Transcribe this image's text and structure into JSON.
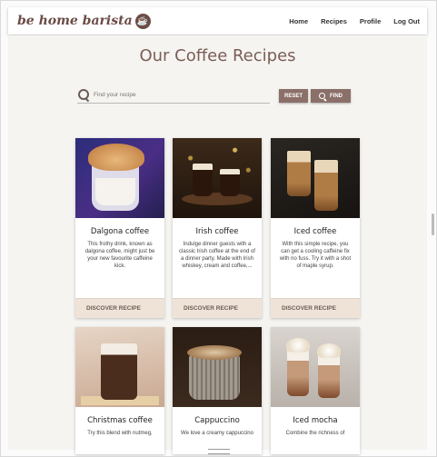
{
  "brand": {
    "name": "be home barista",
    "logo_icon": "coffee-cup-icon"
  },
  "nav": {
    "items": [
      "Home",
      "Recipes",
      "Profile",
      "Log Out"
    ]
  },
  "page": {
    "title": "Our Coffee Recipes"
  },
  "search": {
    "placeholder": "Find your recipe",
    "reset_label": "RESET",
    "find_label": "FIND"
  },
  "recipes": [
    {
      "title": "Dalgona coffee",
      "description": "This frothy drink, known as dalgona coffee, might just be your new favourite caffeine kick.",
      "action": "DISCOVER RECIPE"
    },
    {
      "title": "Irish coffee",
      "description": "Indulge dinner guests with a classic Irish coffee at the end of a dinner party. Made with Irish whiskey, cream and coffee,...",
      "action": "DISCOVER RECIPE"
    },
    {
      "title": "Iced coffee",
      "description": "With this simple recipe, you can get a cooling caffeine fix with no fuss. Try it with a shot of maple syrup.",
      "action": "DISCOVER RECIPE"
    },
    {
      "title": "Christmas coffee",
      "description": "Try this blend with nutmeg,",
      "action": ""
    },
    {
      "title": "Cappuccino",
      "description": "We love a creamy cappuccino",
      "action": ""
    },
    {
      "title": "Iced mocha",
      "description": "Combine the richness of",
      "action": ""
    }
  ],
  "colors": {
    "accent": "#8b6f69",
    "brand": "#6b4b45",
    "card_action_bg": "#efe3d7"
  }
}
